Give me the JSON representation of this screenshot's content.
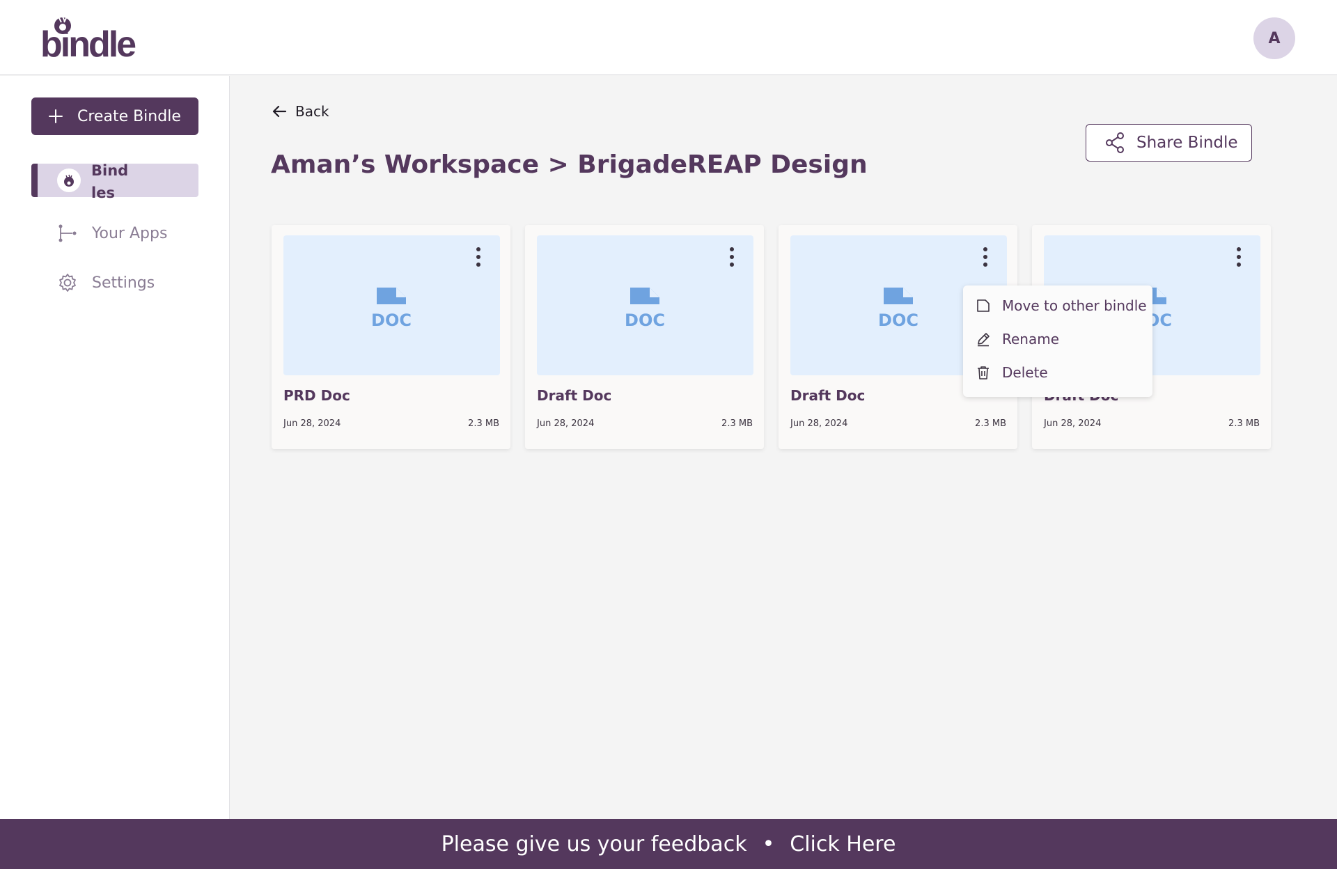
{
  "header": {
    "logo_text": "bindle",
    "avatar_initial": "A"
  },
  "sidebar": {
    "create_label": "Create Bindle",
    "items": [
      {
        "label": "Bindles",
        "active": true
      },
      {
        "label": "Your Apps"
      },
      {
        "label": "Settings"
      }
    ]
  },
  "main": {
    "back_label": "Back",
    "title": "Aman’s Workspace > BrigadeREAP Design",
    "share_label": "Share Bindle",
    "cards": [
      {
        "title": "PRD Doc",
        "date": "Jun 28, 2024",
        "size": "2.3 MB",
        "type_label": "DOC"
      },
      {
        "title": "Draft Doc",
        "date": "Jun 28, 2024",
        "size": "2.3 MB",
        "type_label": "DOC"
      },
      {
        "title": "Draft Doc",
        "date": "Jun 28, 2024",
        "size": "2.3 MB",
        "type_label": "DOC"
      },
      {
        "title": "Draft Doc",
        "date": "Jun 28, 2024",
        "size": "2.3 MB",
        "type_label": "DOC"
      }
    ]
  },
  "context_menu": {
    "items": [
      {
        "label": "Move to other bindle",
        "icon": "folder-icon"
      },
      {
        "label": "Rename",
        "icon": "pencil-icon"
      },
      {
        "label": "Delete",
        "icon": "trash-icon"
      }
    ]
  },
  "footer": {
    "text": "Please give us your feedback",
    "separator": "•",
    "link": "Click Here"
  },
  "colors": {
    "brand": "#54385d",
    "active_bg": "#dcd4e6",
    "thumb_bg": "#e3effd",
    "doc_icon": "#6fa3e0"
  }
}
